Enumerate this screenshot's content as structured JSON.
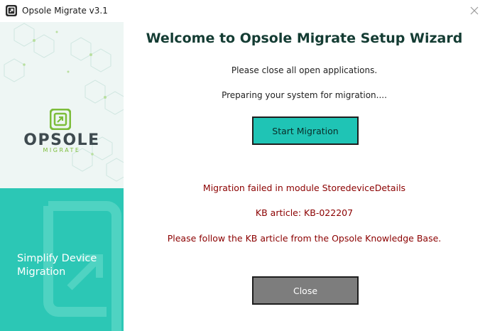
{
  "window": {
    "title": "Opsole Migrate v3.1"
  },
  "sidebar": {
    "logo_word": "OPSOLE",
    "logo_sub": "MIGRATE",
    "tagline_line1": "Simplify Device",
    "tagline_line2": "Migration"
  },
  "main": {
    "heading": "Welcome to Opsole Migrate Setup Wizard",
    "instruction": "Please close all open applications.",
    "status": "Preparing your system for migration....",
    "start_button": "Start Migration",
    "error_module": "Migration failed in module StoredeviceDetails",
    "error_kb": "KB article: KB-022207",
    "error_followup": "Please follow the KB article from the Opsole Knowledge Base.",
    "close_button": "Close"
  },
  "colors": {
    "accent": "#2cc7b5",
    "error": "#8b0000",
    "brand_green": "#7cbd3a"
  }
}
